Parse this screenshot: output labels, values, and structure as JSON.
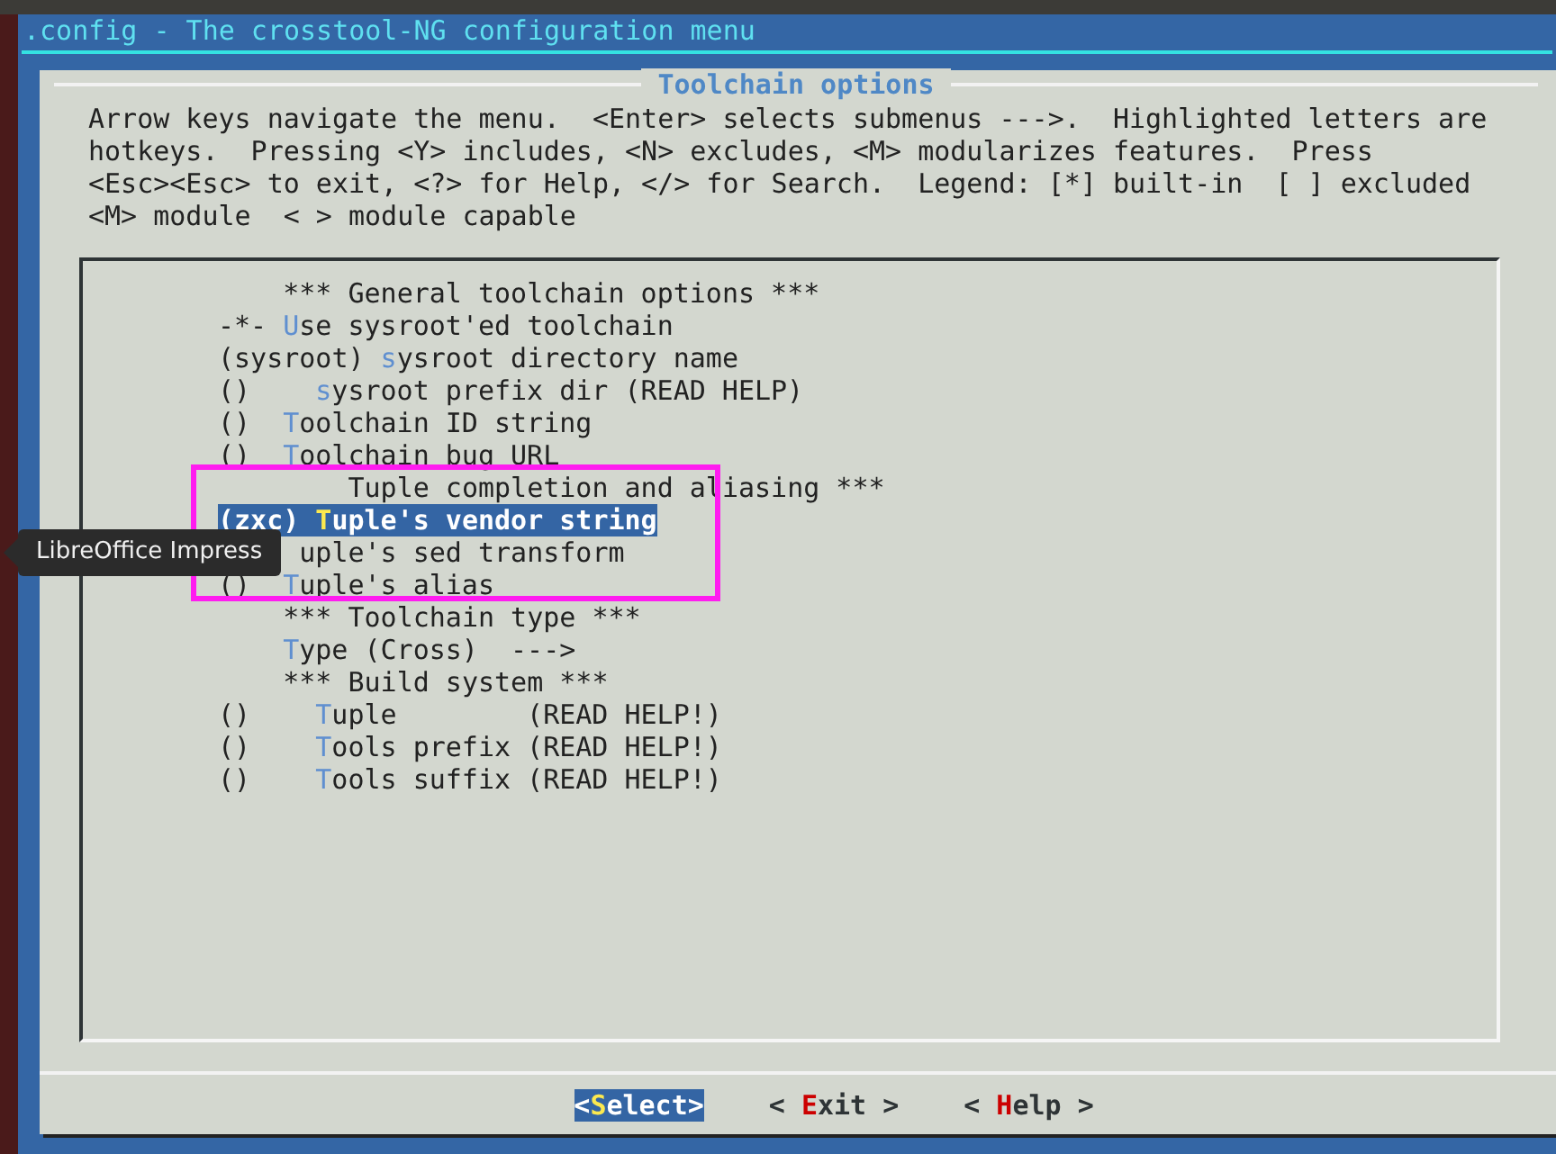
{
  "terminal": {
    "title": ".config - The crosstool-NG configuration menu"
  },
  "dialog": {
    "title": "Toolchain options",
    "help": [
      "Arrow keys navigate the menu.  <Enter> selects submenus --->.  Highlighted letters are",
      "hotkeys.  Pressing <Y> includes, <N> excludes, <M> modularizes features.  Press",
      "<Esc><Esc> to exit, <?> for Help, </> for Search.  Legend: [*] built-in  [ ] excluded",
      "<M> module  < > module capable"
    ],
    "menu": [
      {
        "kind": "comment",
        "text": "*** General toolchain options ***"
      },
      {
        "kind": "option",
        "prefix": "-*-",
        "hotkey": "U",
        "label": "se sysroot'ed toolchain",
        "selected": false
      },
      {
        "kind": "option",
        "prefix": "(sysroot)",
        "hotkey": "s",
        "label": "ysroot directory name",
        "selected": false
      },
      {
        "kind": "indented",
        "prefix": "()",
        "hotkey": "s",
        "label": "ysroot prefix dir (READ HELP)",
        "selected": false
      },
      {
        "kind": "option",
        "prefix": "()",
        "hotkey": "T",
        "label": "oolchain ID string",
        "selected": false
      },
      {
        "kind": "option",
        "prefix": "()",
        "hotkey": "T",
        "label": "oolchain bug URL",
        "selected": false
      },
      {
        "kind": "partial-comment",
        "text": "Tuple completion and aliasing ***"
      },
      {
        "kind": "option",
        "prefix": "(zxc)",
        "hotkey": "T",
        "label": "uple's vendor string",
        "selected": true
      },
      {
        "kind": "partial",
        "text": "uple's sed transform"
      },
      {
        "kind": "option",
        "prefix": "()",
        "hotkey": "T",
        "label": "uple's alias",
        "selected": false
      },
      {
        "kind": "comment",
        "text": "*** Toolchain type ***"
      },
      {
        "kind": "option",
        "hotkey": "T",
        "label": "ype (Cross)  --->",
        "selected": false
      },
      {
        "kind": "comment",
        "text": "*** Build system ***"
      },
      {
        "kind": "indented",
        "prefix": "()",
        "hotkey": "T",
        "label": "uple        (READ HELP!)",
        "selected": false
      },
      {
        "kind": "indented",
        "prefix": "()",
        "hotkey": "T",
        "label": "ools prefix (READ HELP!)",
        "selected": false
      },
      {
        "kind": "indented",
        "prefix": "()",
        "hotkey": "T",
        "label": "ools suffix (READ HELP!)",
        "selected": false
      }
    ],
    "buttons": [
      {
        "left": "<",
        "hotkey": "S",
        "label": "elect",
        "right": ">",
        "selected": true
      },
      {
        "left": "<",
        "hotkey": "E",
        "label": "xit",
        "right": ">",
        "selected": false
      },
      {
        "left": "<",
        "hotkey": "H",
        "label": "elp",
        "right": ">",
        "selected": false
      }
    ]
  },
  "tooltip": {
    "text": "LibreOffice Impress"
  }
}
